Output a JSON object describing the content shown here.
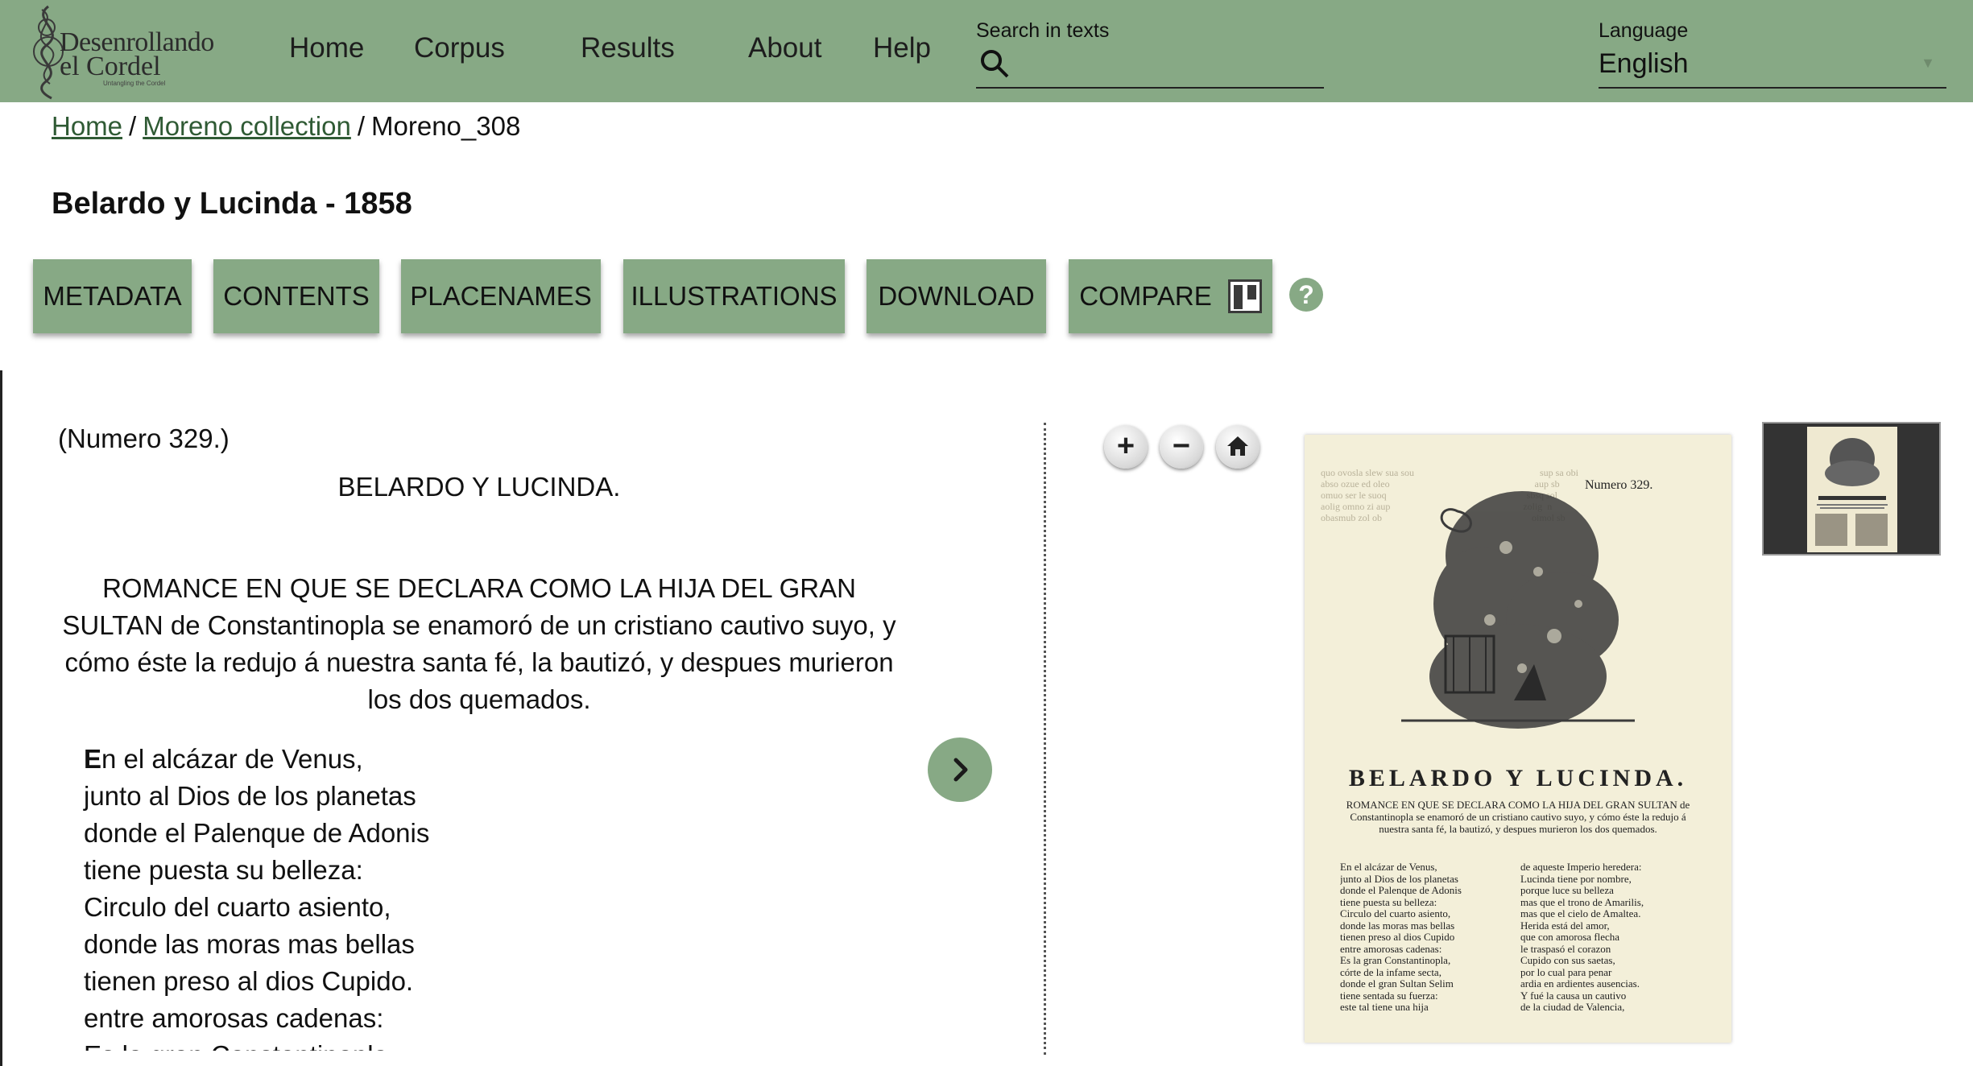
{
  "header": {
    "logo": {
      "line1": "Desenrollando",
      "line2": "el Cordel",
      "tagline": "Untangling the Cordel"
    },
    "nav": [
      "Home",
      "Corpus",
      "Results",
      "About",
      "Help"
    ],
    "search": {
      "label": "Search in texts",
      "value": ""
    },
    "language": {
      "label": "Language",
      "value": "English"
    }
  },
  "breadcrumb": {
    "home": "Home",
    "collection": "Moreno collection",
    "current": "Moreno_308",
    "separator": "/"
  },
  "page_title": "Belardo y Lucinda - 1858",
  "tabs": [
    "METADATA",
    "CONTENTS",
    "PLACENAMES",
    "ILLUSTRATIONS",
    "DOWNLOAD",
    "COMPARE"
  ],
  "help": "?",
  "text": {
    "numero": "(Numero 329.)",
    "title": "BELARDO Y LUCINDA.",
    "subtitle": "ROMANCE EN QUE SE DECLARA COMO LA HIJA DEL GRAN SULTAN de Constantinopla se enamoró de un cristiano cautivo suyo, y cómo éste la redujo á nuestra santa fé, la bautizó, y despues murieron los dos quemados.",
    "verse_initial": "E",
    "verse_first_rest": "n el alcázar de Venus,",
    "verses": [
      "junto al Dios de los planetas",
      "donde el Palenque de Adonis",
      "tiene puesta su belleza:",
      "Circulo del cuarto asiento,",
      "donde las moras mas bellas",
      "tienen preso al dios Cupido.",
      "entre amorosas cadenas:",
      "Es la gran Constantinopla"
    ]
  },
  "viewer": {
    "scan_number": "Numero 329.",
    "scan_title": "BELARDO Y LUCINDA.",
    "scan_subtitle": "ROMANCE EN QUE SE DECLARA COMO LA HIJA DEL GRAN SULTAN de Constantinopla se enamoró de un cristiano cautivo suyo, y cómo éste la redujo á nuestra santa fé, la bautizó, y despues murieron los dos quemados.",
    "scan_col1": [
      "En el alcázar de Venus,",
      "junto al Dios de los planetas",
      "donde el Palenque de Adonis",
      "tiene puesta su belleza:",
      "Circulo del cuarto asiento,",
      "donde las moras mas bellas",
      "tienen preso al dios Cupido",
      "entre amorosas cadenas:",
      "Es la gran Constantinopla,",
      "córte de la infame secta,",
      "donde el gran Sultan Selim",
      "tiene sentada su fuerza:",
      "este tal tiene una hija"
    ],
    "scan_col2": [
      "de aqueste Imperio heredera:",
      "Lucinda tiene por nombre,",
      "porque luce su belleza",
      "mas que el trono de Amarilis,",
      "mas que el cielo de Amaltea.",
      "Herida está del amor,",
      "que con amorosa flecha",
      "le traspasó el corazon",
      "Cupido con sus saetas,",
      "por lo cual para penar",
      "ardia en ardientes ausencias.",
      "Y fué la causa un cautivo",
      "de la ciudad de Valencia,"
    ]
  },
  "colors": {
    "header_bg": "#87a985",
    "link": "#2f5a34",
    "button": "#87a985"
  }
}
